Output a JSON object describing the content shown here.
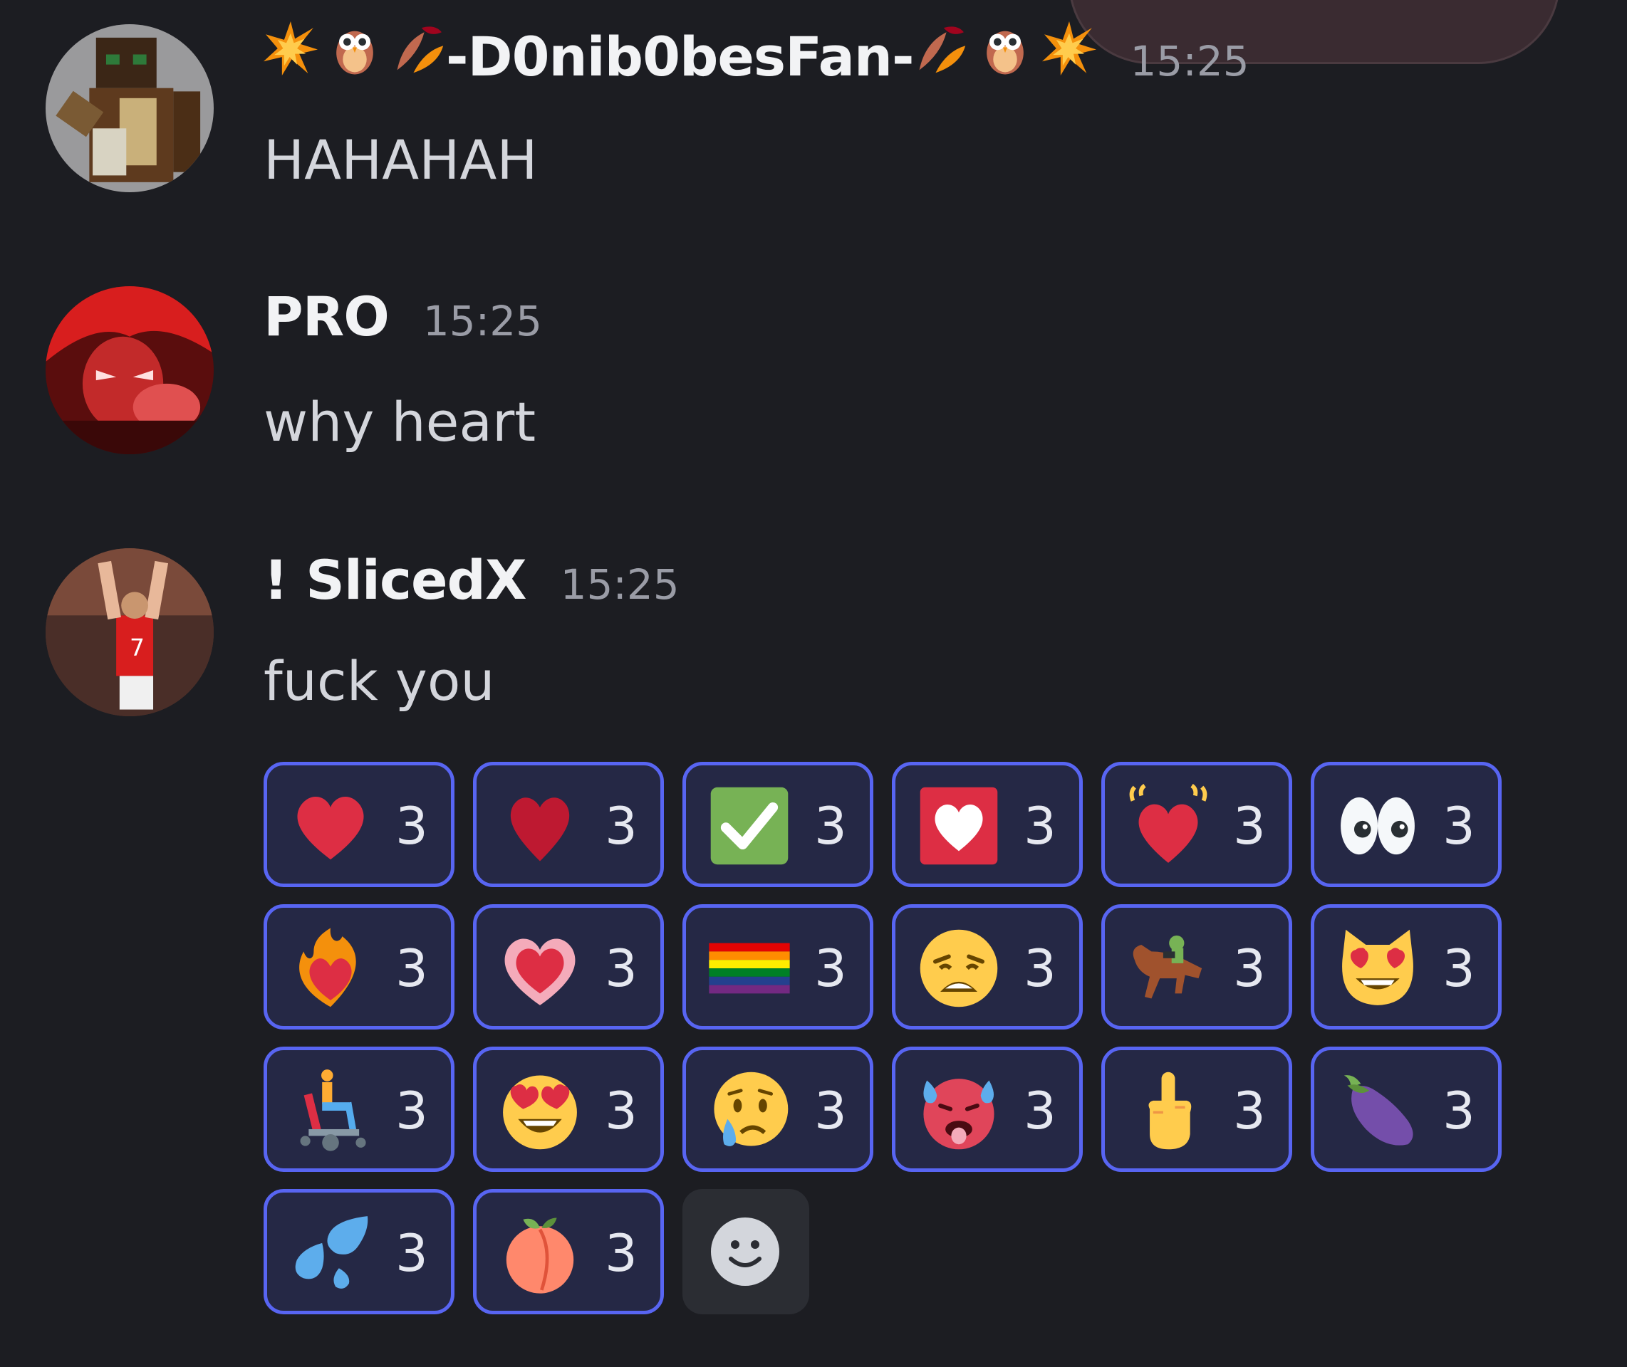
{
  "messages": [
    {
      "username_text": "-D0nib0besFan-",
      "timestamp": "15:25",
      "content": "HAHAHAH",
      "username_emojis": [
        "collision-icon",
        "owl-icon",
        "fallen-leaves-icon",
        "fallen-leaves-icon",
        "owl-icon",
        "collision-icon"
      ]
    },
    {
      "username_text": "PRO",
      "timestamp": "15:25",
      "content": "why heart"
    },
    {
      "username_text": "! SlicedX",
      "timestamp": "15:25",
      "content": "fuck you"
    }
  ],
  "reactions": [
    {
      "icon": "red-heart-icon",
      "count": "3"
    },
    {
      "icon": "dark-red-heart-icon",
      "count": "3"
    },
    {
      "icon": "check-mark-button-icon",
      "count": "3"
    },
    {
      "icon": "heart-suit-box-icon",
      "count": "3"
    },
    {
      "icon": "beating-heart-icon",
      "count": "3"
    },
    {
      "icon": "eyes-icon",
      "count": "3"
    },
    {
      "icon": "heart-on-fire-icon",
      "count": "3"
    },
    {
      "icon": "growing-heart-icon",
      "count": "3"
    },
    {
      "icon": "rainbow-flag-icon",
      "count": "3"
    },
    {
      "icon": "weary-face-icon",
      "count": "3"
    },
    {
      "icon": "horse-racing-icon",
      "count": "3"
    },
    {
      "icon": "heart-eyes-cat-icon",
      "count": "3"
    },
    {
      "icon": "motorized-wheelchair-icon",
      "count": "3"
    },
    {
      "icon": "heart-eyes-face-icon",
      "count": "3"
    },
    {
      "icon": "crying-face-icon",
      "count": "3"
    },
    {
      "icon": "hot-face-icon",
      "count": "3"
    },
    {
      "icon": "middle-finger-icon",
      "count": "3"
    },
    {
      "icon": "eggplant-icon",
      "count": "3"
    },
    {
      "icon": "sweat-droplets-icon",
      "count": "3"
    },
    {
      "icon": "peach-icon",
      "count": "3"
    }
  ],
  "add_reaction": {
    "icon": "add-reaction-smiley-icon"
  },
  "colors": {
    "background": "#1c1d22",
    "reaction_border": "#5865f2",
    "reaction_bg": "#252845",
    "timestamp": "#9a9ca6"
  }
}
